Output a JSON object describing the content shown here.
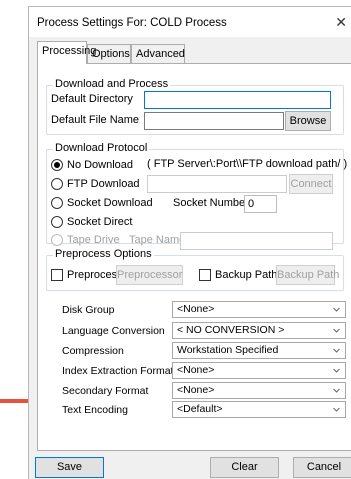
{
  "window": {
    "title": "Process Settings For: COLD Process",
    "close_glyph": "✕"
  },
  "tabs": [
    "Processing",
    "Options",
    "Advanced"
  ],
  "download_and_process": {
    "legend": "Download and Process",
    "default_directory_label": "Default Directory",
    "default_directory_value": "",
    "default_file_name_label": "Default File Name",
    "default_file_name_value": "",
    "browse_label": "Browse"
  },
  "download_protocol": {
    "legend": "Download Protocol",
    "no_download": "No Download",
    "hint": "( FTP Server\\:Port\\\\FTP download path/ )",
    "ftp_download": "FTP Download",
    "ftp_value": "",
    "connect_label": "Connect",
    "socket_download": "Socket Download",
    "socket_number_label": "Socket Number",
    "socket_number_value": "0",
    "socket_direct": "Socket Direct",
    "tape_drive": "Tape Drive",
    "tape_name_label": "Tape Name",
    "tape_name_value": ""
  },
  "preprocess_options": {
    "legend": "Preprocess Options",
    "preprocess_label": "Preprocess",
    "preprocessor_button": "Preprocessor",
    "backup_path_label": "Backup Path",
    "backup_path_button": "Backup Path"
  },
  "settings": [
    {
      "label": "Disk Group",
      "value": "<None>"
    },
    {
      "label": "Language Conversion",
      "value": "< NO CONVERSION >"
    },
    {
      "label": "Compression",
      "value": "Workstation Specified"
    },
    {
      "label": "Index Extraction Format",
      "value": "<None>"
    },
    {
      "label": "Secondary Format",
      "value": "<None>"
    },
    {
      "label": "Text Encoding",
      "value": "<Default>"
    }
  ],
  "footer": {
    "save": "Save",
    "clear": "Clear",
    "cancel": "Cancel"
  },
  "colors": {
    "arrow": "#e8513a",
    "focus_border": "#0078d7"
  }
}
